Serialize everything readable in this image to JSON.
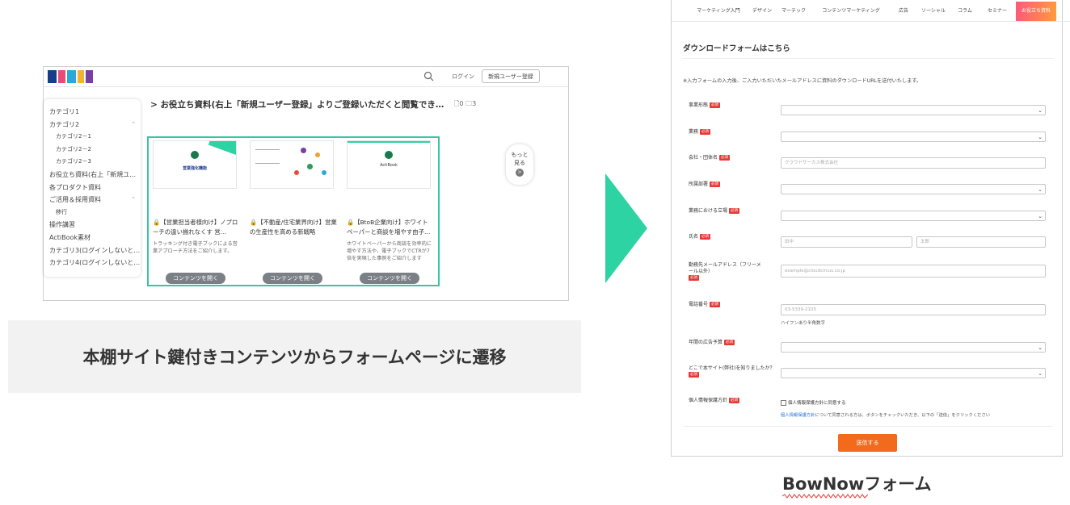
{
  "left_screenshot": {
    "header": {
      "login": "ログイン",
      "register": "新規ユーザー登録"
    },
    "sidebar": {
      "items": [
        {
          "label": "カテゴリ1",
          "sub": false,
          "chevron": false
        },
        {
          "label": "カテゴリ2",
          "sub": false,
          "chevron": true
        },
        {
          "label": "カテゴリ2－1",
          "sub": true,
          "chevron": false
        },
        {
          "label": "カテゴリ2－2",
          "sub": true,
          "chevron": false
        },
        {
          "label": "カテゴリ2－3",
          "sub": true,
          "chevron": false
        },
        {
          "label": "お役立ち資料(右上「新規ユ…",
          "sub": false,
          "chevron": false
        },
        {
          "label": "各プロダクト資料",
          "sub": false,
          "chevron": false
        },
        {
          "label": "ご活用＆採用資料",
          "sub": false,
          "chevron": true
        },
        {
          "label": "移行",
          "sub": true,
          "chevron": false
        },
        {
          "label": "操作講習",
          "sub": false,
          "chevron": false
        },
        {
          "label": "ActiBook素材",
          "sub": false,
          "chevron": false
        },
        {
          "label": "カテゴリ3(ログインしないと…",
          "sub": false,
          "chevron": false
        },
        {
          "label": "カテゴリ4(ログインしないと…",
          "sub": false,
          "chevron": false
        }
      ]
    },
    "title": "> お役立ち資料(右上「新規ユーザー登録」よりご登録いただくと閲覧でき…",
    "counts": "🗋0 🗀3",
    "cards": [
      {
        "thumb_text": "営業強化機能",
        "title": "🔒【営業担当者様向け】ノプローチの違い揃れなくす 営…",
        "desc": "トラッキング付き電子ブックによる営業アプローチ方法をご紹介します。",
        "button": "コンテンツを開く"
      },
      {
        "thumb_text": "",
        "title": "🔒【不動産/住宅業界向け】営業の生産性を高める新戦略",
        "desc": "",
        "button": "コンテンツを開く"
      },
      {
        "thumb_text": "ActiBook",
        "title": "🔒【BtoB企業向け】ホワイトペーパーと商談を増やす由子…",
        "desc": "ホワイトペーパーから商談を効率的に増やす方法や、電子ブックでCTRが7倍を実現した事例をご紹介します",
        "button": "コンテンツを開く"
      }
    ],
    "more": {
      "line1": "もっと",
      "line2": "見る",
      "icon": ">"
    }
  },
  "caption": "本棚サイト鍵付きコンテンツからフォームページに遷移",
  "form": {
    "nav": [
      "マーケティング入門",
      "デザイン",
      "マーテック",
      "コンテンツマーケティング",
      "広告",
      "ソーシャル",
      "コラム",
      "セミナー",
      "お役立ち資料"
    ],
    "title": "ダウンロードフォームはこちら",
    "note": "※入力フォームの入力後、ご入力いただいたメールアドレスに資料のダウンロードURLを送付いたします。",
    "required": "必須",
    "fields": {
      "industry": "事業形態",
      "role": "業務",
      "company": "会社・団体名",
      "company_ph": "クラウドサーカス株式会社",
      "dept": "所属部署",
      "position": "業務における立場",
      "name": "氏名",
      "last_ph": "田中",
      "first_ph": "太郎",
      "email": "勤務先メールアドレス（フリーメール以外）",
      "email_ph": "example@cloudcircus.co.jp",
      "phone": "電話番号",
      "phone_ph": "03-5339-2105",
      "phone_hint": "ハイフンあり半角数字",
      "budget": "年間の広告予算",
      "source": "どこで本サイト(弊社)を知りましたか？",
      "privacy": "個人情報保護方針",
      "privacy_check": "個人情報保護方針に同意する",
      "privacy_link": "個人情報保護方針",
      "privacy_rest": "について同意される方は、ボタンをチェックいただき、以下の「送信」をクリックください"
    },
    "submit": "送信する"
  },
  "form_caption": "BowNowフォーム",
  "colors": {
    "accent_green": "#2ed3a3",
    "submit_orange": "#f26b1d",
    "required_red": "#e53935"
  }
}
